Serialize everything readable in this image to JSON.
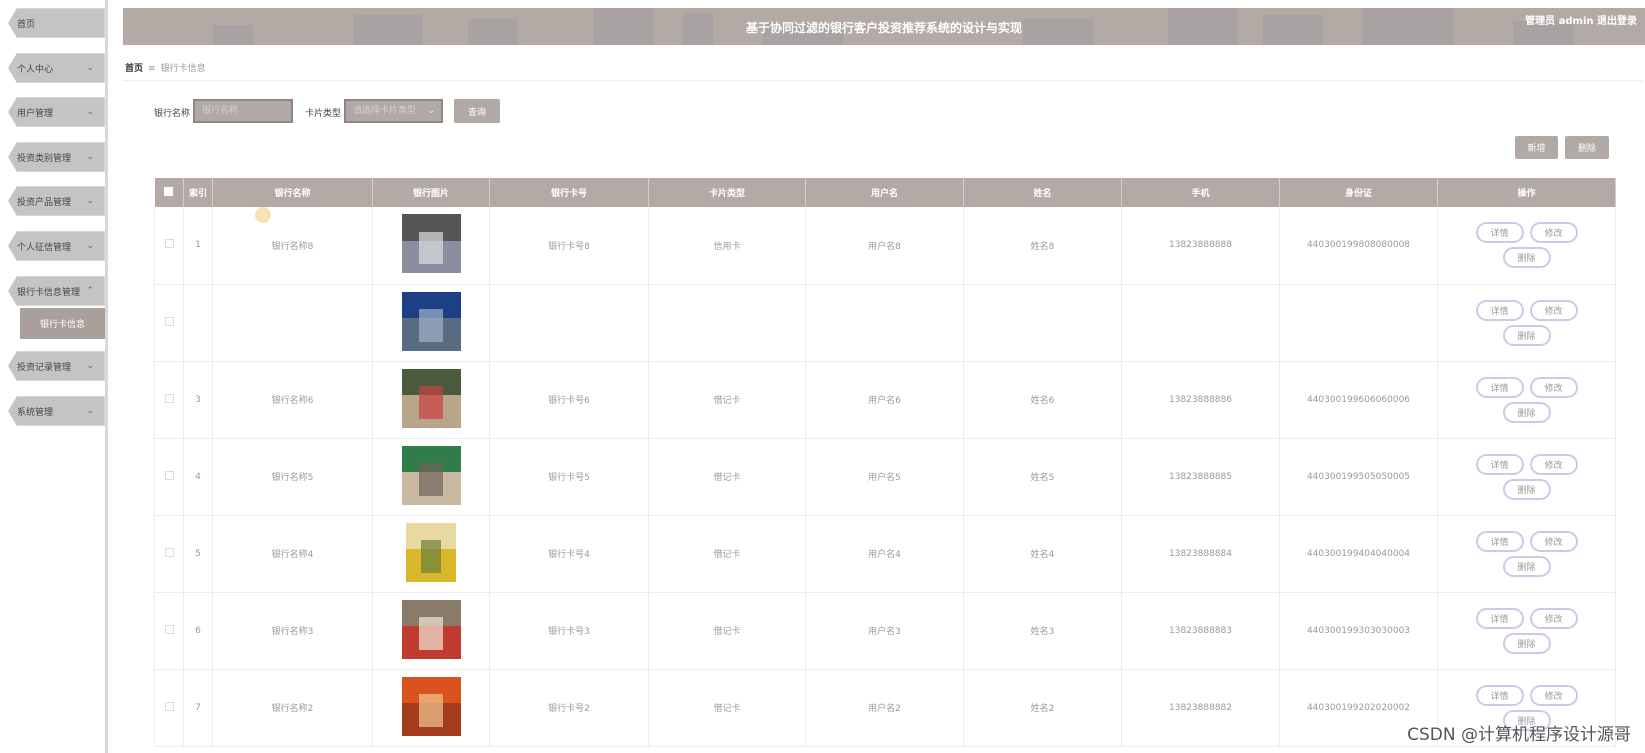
{
  "sidebar": {
    "items": [
      {
        "label": "首页"
      },
      {
        "label": "个人中心"
      },
      {
        "label": "用户管理"
      },
      {
        "label": "投资类别管理"
      },
      {
        "label": "投资产品管理"
      },
      {
        "label": "个人征信管理"
      },
      {
        "label": "银行卡信息管理"
      },
      {
        "label": "投资记录管理"
      },
      {
        "label": "系统管理"
      }
    ],
    "sub_item": "银行卡信息",
    "chevron_down": "⌄",
    "chevron_up": "⌃"
  },
  "header": {
    "title": "基于协同过滤的银行客户投资推荐系统的设计与实现",
    "admin": "管理员 admin  退出登录"
  },
  "breadcrumb": {
    "home": "首页",
    "sep": "≡",
    "current": "银行卡信息"
  },
  "search": {
    "bank_label": "银行名称",
    "bank_placeholder": "银行名称",
    "type_label": "卡片类型",
    "type_placeholder": "请选择卡片类型",
    "query_btn": "查询"
  },
  "actions": {
    "add": "新增",
    "delete": "删除"
  },
  "table": {
    "headers": [
      "索引",
      "银行名称",
      "银行图片",
      "银行卡号",
      "卡片类型",
      "用户名",
      "姓名",
      "手机",
      "身份证",
      "操作"
    ],
    "op_labels": {
      "detail": "详情",
      "edit": "修改",
      "delete": "删除"
    },
    "rows": [
      {
        "index": "1",
        "bank": "银行名称8",
        "card": "银行卡号8",
        "type": "信用卡",
        "user": "用户名8",
        "name": "姓名8",
        "phone": "13823888888",
        "id": "440300199808080008"
      },
      {
        "index": "",
        "bank": "",
        "card": "",
        "type": "",
        "user": "",
        "name": "",
        "phone": "",
        "id": ""
      },
      {
        "index": "3",
        "bank": "银行名称6",
        "card": "银行卡号6",
        "type": "借记卡",
        "user": "用户名6",
        "name": "姓名6",
        "phone": "13823888886",
        "id": "440300199606060006"
      },
      {
        "index": "4",
        "bank": "银行名称5",
        "card": "银行卡号5",
        "type": "借记卡",
        "user": "用户名5",
        "name": "姓名5",
        "phone": "13823888885",
        "id": "440300199505050005"
      },
      {
        "index": "5",
        "bank": "银行名称4",
        "card": "银行卡号4",
        "type": "借记卡",
        "user": "用户名4",
        "name": "姓名4",
        "phone": "13823888884",
        "id": "440300199404040004"
      },
      {
        "index": "6",
        "bank": "银行名称3",
        "card": "银行卡号3",
        "type": "借记卡",
        "user": "用户名3",
        "name": "姓名3",
        "phone": "13823888883",
        "id": "440300199303030003"
      },
      {
        "index": "7",
        "bank": "银行名称2",
        "card": "银行卡号2",
        "type": "借记卡",
        "user": "用户名2",
        "name": "姓名2",
        "phone": "13823888882",
        "id": "440300199202020002"
      }
    ]
  },
  "watermark": "CSDN @计算机程序设计源哥"
}
